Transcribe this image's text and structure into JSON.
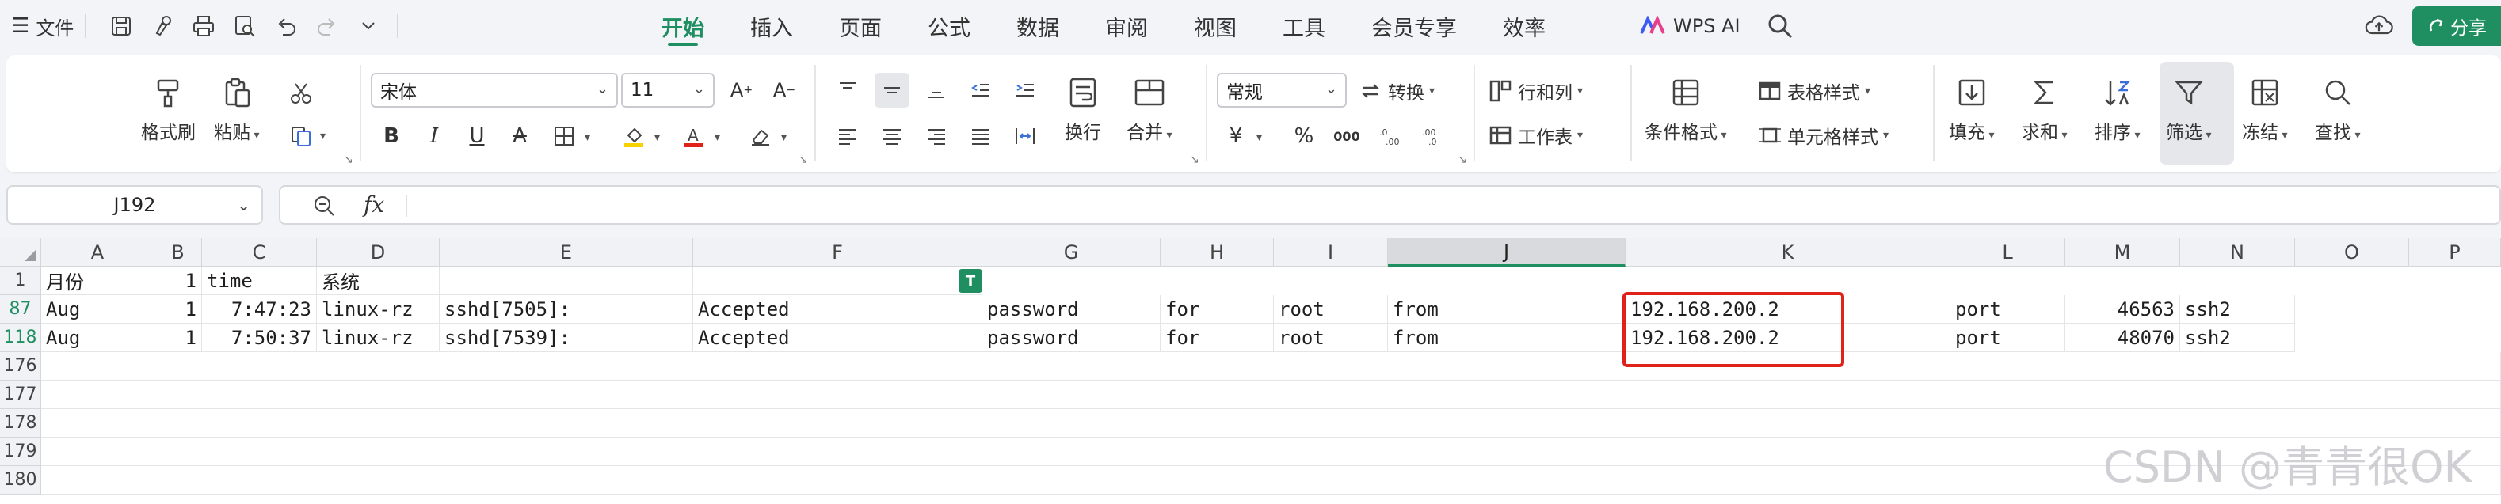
{
  "menubar": {
    "file_label": "文件",
    "tabs": [
      "开始",
      "插入",
      "页面",
      "公式",
      "数据",
      "审阅",
      "视图",
      "工具",
      "会员专享",
      "效率"
    ],
    "active_tab": "开始",
    "wps_ai_label": "WPS AI",
    "share_label": "分享"
  },
  "ribbon": {
    "format_painter": "格式刷",
    "paste": "粘贴",
    "font_name": "宋体",
    "font_size": "11",
    "wrap_text": "换行",
    "merge": "合并",
    "number_format": "常规",
    "convert": "转换",
    "row_col": "行和列",
    "worksheet": "工作表",
    "cond_format": "条件格式",
    "table_style": "表格样式",
    "cell_style": "单元格样式",
    "fill": "填充",
    "sum": "求和",
    "sort": "排序",
    "filter": "筛选",
    "freeze": "冻结",
    "find": "查找",
    "currency_symbol": "¥",
    "percent_symbol": "%",
    "thousands_symbol": "000"
  },
  "formula_bar": {
    "cell_ref": "J192",
    "fx_label": "fx",
    "content": ""
  },
  "grid": {
    "columns": [
      "A",
      "B",
      "C",
      "D",
      "E",
      "F",
      "G",
      "H",
      "I",
      "J",
      "K",
      "L",
      "M",
      "N",
      "O",
      "P"
    ],
    "selected_column": "J",
    "row_numbers": [
      "1",
      "87",
      "118",
      "176",
      "177",
      "178",
      "179",
      "180"
    ],
    "row1": {
      "A": "月份",
      "B": "1",
      "C": "time",
      "D": "系统"
    },
    "row87": {
      "A": "Aug",
      "B": "1",
      "C": "7:47:23",
      "D": "linux-rz",
      "E": "sshd[7505]:",
      "F": "Accepted",
      "G": "password",
      "H": "for",
      "I": "root",
      "J": "from",
      "K": "192.168.200.2",
      "L": "port",
      "M": "46563",
      "N": "ssh2"
    },
    "row118": {
      "A": "Aug",
      "B": "1",
      "C": "7:50:37",
      "D": "linux-rz",
      "E": "sshd[7539]:",
      "F": "Accepted",
      "G": "password",
      "H": "for",
      "I": "root",
      "J": "from",
      "K": "192.168.200.2",
      "L": "port",
      "M": "48070",
      "N": "ssh2"
    },
    "filter_marker": "T"
  },
  "watermark": "CSDN @青青很OK",
  "colors": {
    "accent": "#1f8f62",
    "highlight": "#e0231a"
  }
}
